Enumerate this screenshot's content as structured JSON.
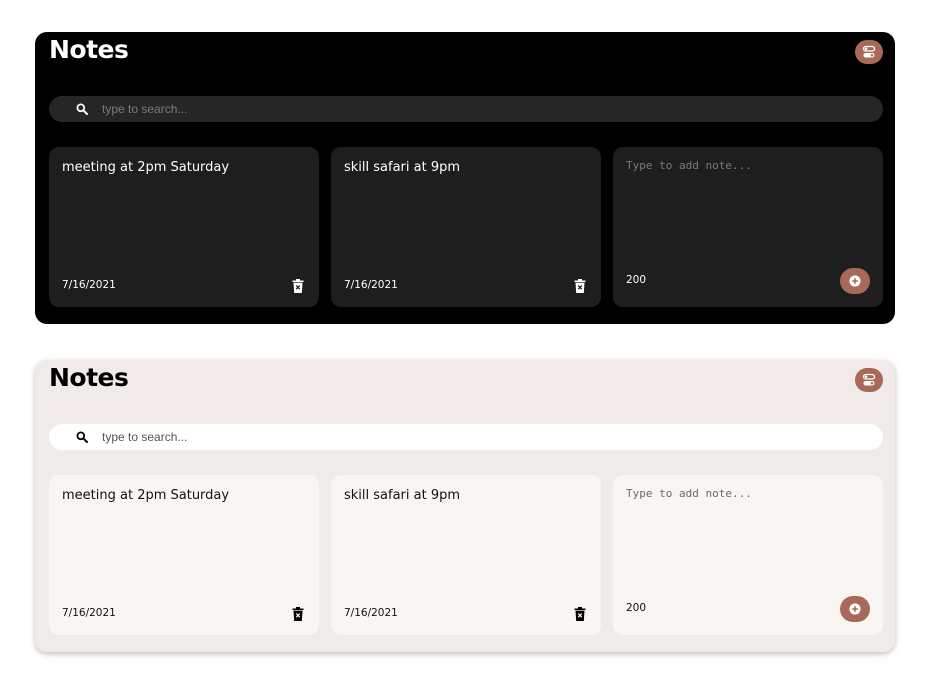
{
  "colors": {
    "accent": "#a86a58",
    "dark_background": "#000000",
    "dark_card": "#1e1e1e",
    "light_background": "#f0ebe8",
    "light_card": "#f8f5f3"
  },
  "icons": {
    "theme_toggle": "toggle-icon",
    "search": "search-icon",
    "delete": "trash-icon",
    "add": "plus-circle-icon"
  },
  "dark_app": {
    "title": "Notes",
    "search": {
      "placeholder": "type to search..."
    },
    "notes": [
      {
        "text": "meeting at 2pm Saturday",
        "date": "7/16/2021"
      },
      {
        "text": "skill safari at 9pm",
        "date": "7/16/2021"
      }
    ],
    "new_note": {
      "placeholder": "Type to add note...",
      "remaining": "200"
    }
  },
  "light_app": {
    "title": "Notes",
    "search": {
      "placeholder": "type to search..."
    },
    "notes": [
      {
        "text": "meeting at 2pm Saturday",
        "date": "7/16/2021"
      },
      {
        "text": "skill safari at 9pm",
        "date": "7/16/2021"
      }
    ],
    "new_note": {
      "placeholder": "Type to add note...",
      "remaining": "200"
    }
  }
}
